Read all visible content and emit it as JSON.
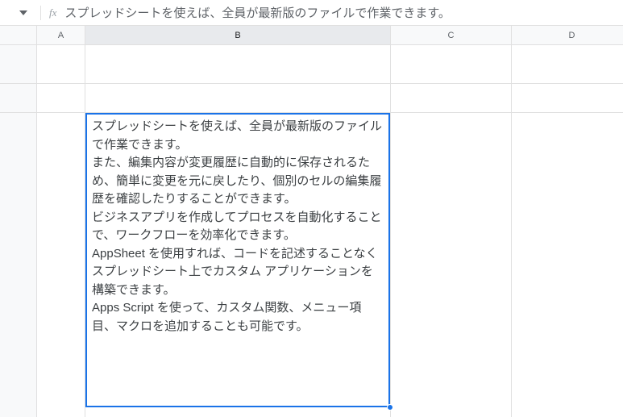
{
  "formula_bar": {
    "fx_label": "fx",
    "content": "スプレッドシートを使えば、全員が最新版のファイルで作業できます。"
  },
  "columns": {
    "A": "A",
    "B": "B",
    "C": "C",
    "D": "D"
  },
  "active_cell": {
    "text": "スプレッドシートを使えば、全員が最新版のファイルで作業できます。\nまた、編集内容が変更履歴に自動的に保存されるため、簡単に変更を元に戻したり、個別のセルの編集履歴を確認したりすることができます。\nビジネスアプリを作成してプロセスを自動化することで、ワークフローを効率化できます。\nAppSheet を使用すれば、コードを記述することなくスプレッドシート上でカスタム アプリケーションを構築できます。\nApps Script を使って、カスタム関数、メニュー項目、マクロを追加することも可能です。"
  }
}
